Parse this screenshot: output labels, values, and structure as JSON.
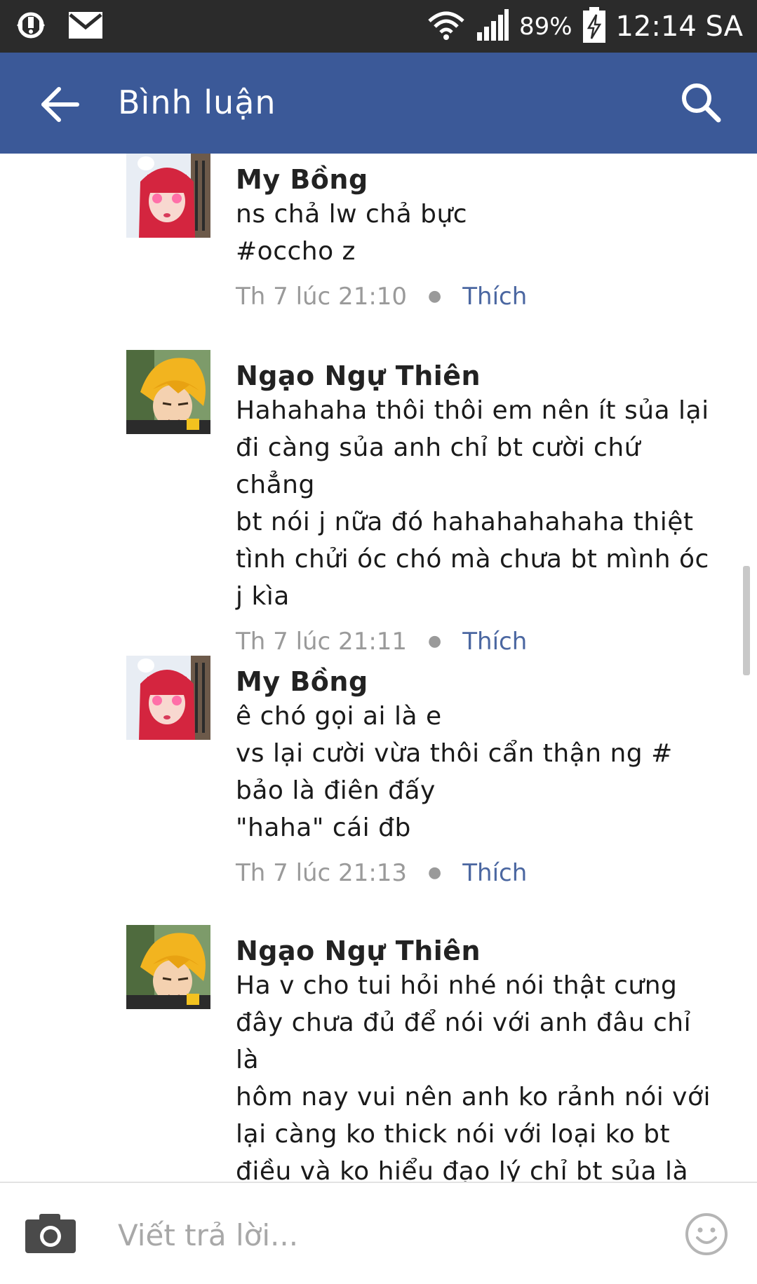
{
  "status_bar": {
    "battery_percent": "89%",
    "time": "12:14 SA"
  },
  "app_bar": {
    "title": "Bình luận"
  },
  "comments": [
    {
      "author": "My Bồng",
      "text": "ns chả lw chả bực\n#occho z",
      "time": "Th 7 lúc 21:10",
      "like_label": "Thích",
      "avatar": "red-hair-avatar"
    },
    {
      "author": "Ngạo Ngự Thiên",
      "text": "Hahahaha thôi thôi em nên ít sủa lại\nđi càng sủa anh chỉ bt cười chứ chẳng\nbt nói j nữa đó hahahahahaha thiệt\ntình chửi óc chó mà chưa bt mình óc\nj kìa",
      "time": "Th 7 lúc 21:11",
      "like_label": "Thích",
      "avatar": "yellow-hair-avatar"
    },
    {
      "author": "My Bồng",
      "text": "ê chó gọi ai là e\nvs lại cười vừa thôi cẩn thận ng #\nbảo là điên đấy\n\"haha\" cái đb",
      "time": "Th 7 lúc 21:13",
      "like_label": "Thích",
      "avatar": "red-hair-avatar"
    },
    {
      "author": "Ngạo Ngự Thiên",
      "text": "Ha v cho tui hỏi nhé nói thật cưng\nđây chưa đủ để nói với anh đâu chỉ là\nhôm nay vui nên anh ko rảnh nói với\nlại càng ko thick nói với loại ko bt\nđiều và ko hiểu đạo lý chỉ bt sủa là\nchính nên anh đây ko thick cãi lại",
      "avatar": "yellow-hair-avatar"
    }
  ],
  "reply_bar": {
    "placeholder": "Viết trả lời..."
  },
  "colors": {
    "app_bar": "#3b5998",
    "status_bar": "#2b2b2b",
    "like_link": "#4b67a1",
    "meta_text": "#9a9a9a"
  },
  "icons": [
    "sync-icon",
    "mail-icon",
    "wifi-icon",
    "signal-icon",
    "battery-icon",
    "back-arrow-icon",
    "search-icon",
    "camera-icon",
    "emoji-icon"
  ]
}
